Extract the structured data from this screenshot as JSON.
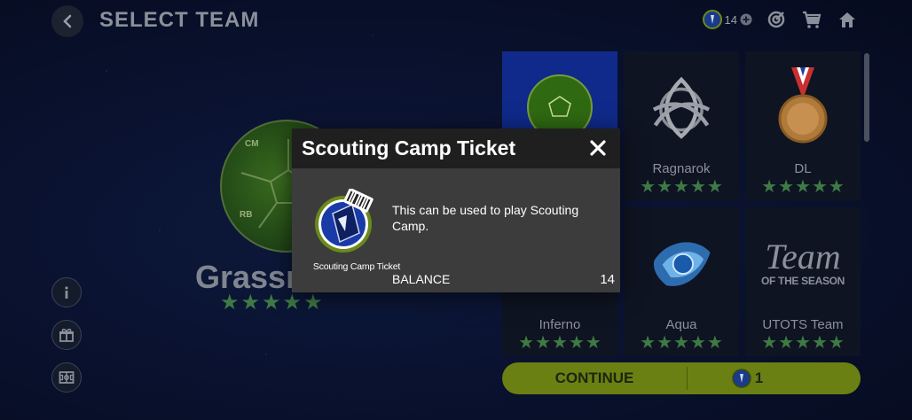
{
  "header": {
    "title": "SELECT TEAM",
    "ticket_count": "14"
  },
  "selected_team": {
    "name": "Grassr",
    "ball_labels": [
      "CM",
      "RB"
    ],
    "stars": 5
  },
  "teams": [
    {
      "name": "",
      "stars": 0,
      "art": "soccer-ball-icon"
    },
    {
      "name": "Ragnarok",
      "stars": 5,
      "art": "triquetra-knot-icon"
    },
    {
      "name": "DL",
      "stars": 5,
      "art": "medal-icon"
    },
    {
      "name": "Inferno",
      "stars": 5,
      "art": "flame-icon"
    },
    {
      "name": "Aqua",
      "stars": 5,
      "art": "water-splash-icon"
    },
    {
      "name": "UTOTS Team",
      "stars": 5,
      "art": "team-of-the-season-logo"
    }
  ],
  "tots_logo": {
    "line1": "Team",
    "line2": "OF THE SEASON"
  },
  "continue": {
    "label": "CONTINUE",
    "cost": "1"
  },
  "modal": {
    "title": "Scouting Camp Ticket",
    "description": "This can be used to play Scouting Camp.",
    "item_caption": "Scouting Camp Ticket",
    "balance_label": "BALANCE",
    "balance_value": "14"
  },
  "star_glyph": "★",
  "colors": {
    "accent_green": "#6b8012",
    "star_green": "#3f7a45",
    "selected_blue": "#0f2a8a"
  }
}
